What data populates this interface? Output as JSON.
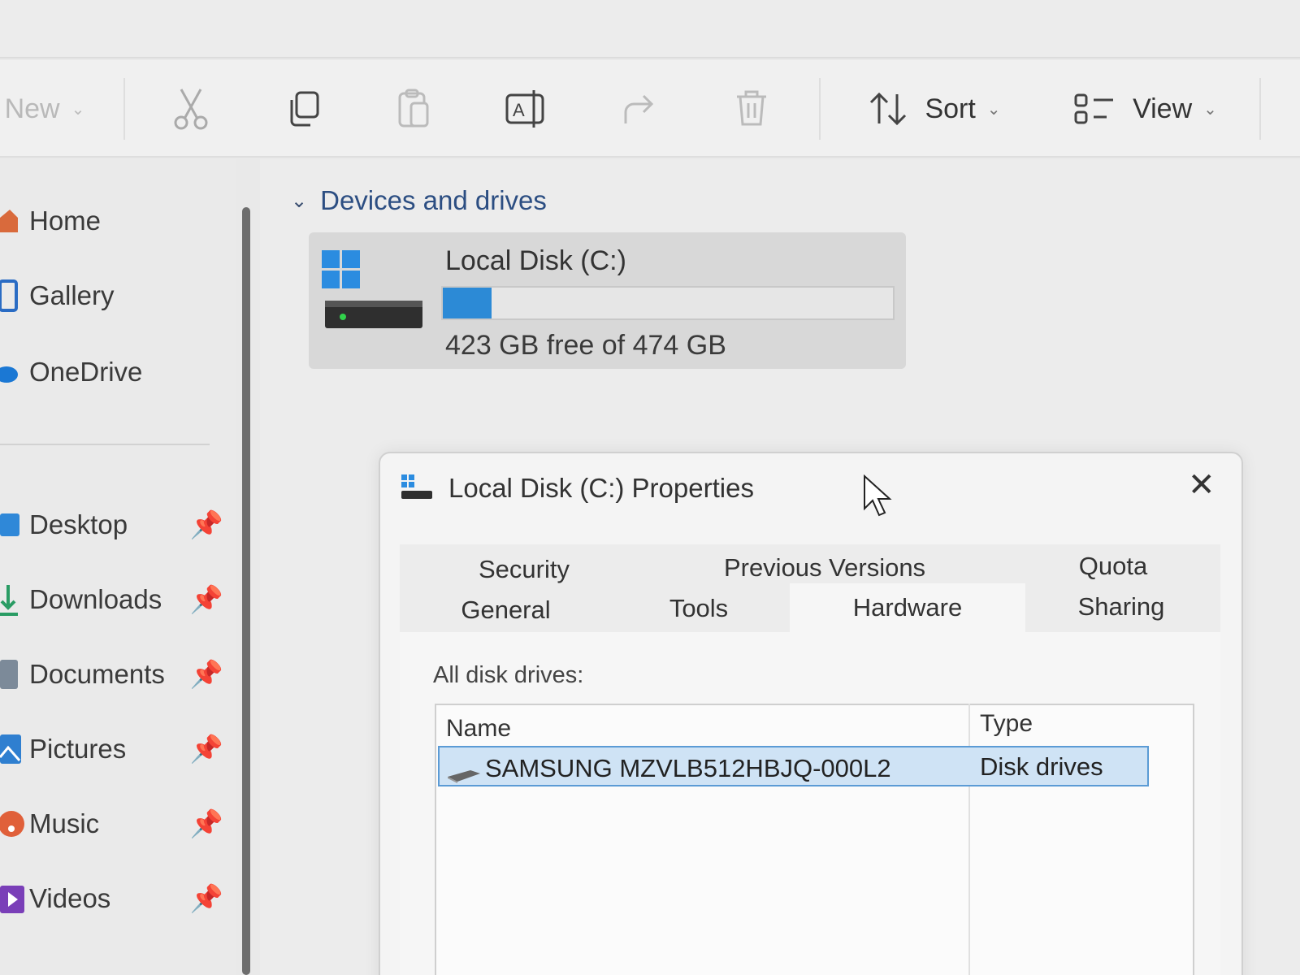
{
  "toolbar": {
    "new_label": "New",
    "sort_label": "Sort",
    "view_label": "View"
  },
  "sidebar": {
    "items": [
      {
        "label": "Home",
        "icon": "home-icon"
      },
      {
        "label": "Gallery",
        "icon": "gallery-icon"
      },
      {
        "label": "OneDrive",
        "icon": "onedrive-icon"
      },
      {
        "label": "Desktop",
        "icon": "desktop-icon",
        "pinned": true
      },
      {
        "label": "Downloads",
        "icon": "downloads-icon",
        "pinned": true
      },
      {
        "label": "Documents",
        "icon": "documents-icon",
        "pinned": true
      },
      {
        "label": "Pictures",
        "icon": "pictures-icon",
        "pinned": true
      },
      {
        "label": "Music",
        "icon": "music-icon",
        "pinned": true
      },
      {
        "label": "Videos",
        "icon": "videos-icon",
        "pinned": true
      }
    ]
  },
  "main": {
    "section_title": "Devices and drives",
    "drive": {
      "name": "Local Disk (C:)",
      "free_text": "423 GB free of 474 GB",
      "used_fraction": 0.108
    }
  },
  "dialog": {
    "title": "Local Disk (C:) Properties",
    "tabs_row1": [
      "Security",
      "Previous Versions",
      "Quota"
    ],
    "tabs_row2": [
      "General",
      "Tools",
      "Hardware",
      "Sharing"
    ],
    "active_tab": "Hardware",
    "all_disks_label": "All disk drives:",
    "columns": [
      "Name",
      "Type"
    ],
    "rows": [
      {
        "name": "SAMSUNG MZVLB512HBJQ-000L2",
        "type": "Disk drives",
        "selected": true
      }
    ]
  },
  "colors": {
    "accent": "#2c8ad6",
    "section_title": "#2c4e82",
    "selection_bg": "#cfe3f5",
    "selection_border": "#5b9bd5"
  }
}
